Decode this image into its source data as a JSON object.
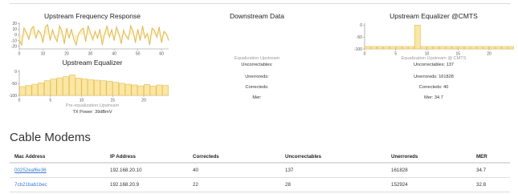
{
  "sections": {
    "upstream_freq": {
      "title": "Upstream Frequency Response"
    },
    "upstream_eq": {
      "title": "Upstream Equalizer",
      "caption1": "Pre-equalization Upstream",
      "caption2": "TX Power: 39dBmV"
    },
    "downstream": {
      "title": "Downstream Data",
      "eq_label": "Equalization Upstream",
      "uncorrectables": "Uncorrectables:",
      "unerroreds": "Unerroreds:",
      "correcteds": "Correcteds:",
      "mer": "Mer:"
    },
    "cmts": {
      "title": "Upstream Equalizer @CMTS",
      "eq_label": "Equalization Upstream @ CMTS",
      "uncorrectables": "Uncorrectables: 137",
      "unerroreds": "Unerroreds: 161828",
      "correcteds": "Correcteds: 40",
      "mer": "Mer: 34.7"
    }
  },
  "cable_modems": {
    "heading": "Cable Modems",
    "columns": [
      "Mac Address",
      "IP Address",
      "Correcteds",
      "Uncorrectables",
      "Unerroreds",
      "MER"
    ],
    "rows": [
      [
        "00252eaf6e36",
        "192.168.20.10",
        "40",
        "137",
        "161828",
        "34.7"
      ],
      [
        "7cb21bab1bec",
        "192.168.20.9",
        "22",
        "28",
        "152924",
        "32.8"
      ]
    ]
  },
  "colors": {
    "fill": "#fbe6a4",
    "stroke": "#e3bd57",
    "link": "#3a7bd5"
  },
  "chart_data": [
    {
      "type": "line",
      "title": "Upstream Frequency Response",
      "xlim": [
        0,
        63
      ],
      "ylim": [
        -25,
        22
      ],
      "xticks": [
        0,
        10,
        20,
        30,
        40,
        50,
        60
      ],
      "yticks": [
        20,
        10,
        0,
        -10,
        -20
      ],
      "ytick_labels": [
        "20",
        "10",
        "0",
        "-10",
        "-20"
      ],
      "x": [
        0,
        1,
        2,
        3,
        4,
        5,
        6,
        7,
        8,
        9,
        10,
        11,
        12,
        13,
        14,
        15,
        16,
        17,
        18,
        19,
        20,
        21,
        22,
        23,
        24,
        25,
        26,
        27,
        28,
        29,
        30,
        31,
        32,
        33,
        34,
        35,
        36,
        37,
        38,
        39,
        40,
        41,
        42,
        43,
        44,
        45,
        46,
        47,
        48,
        49,
        50,
        51,
        52,
        53,
        54,
        55,
        56,
        57,
        58,
        59,
        60,
        61,
        62,
        63
      ],
      "y": [
        -10,
        -18,
        12,
        4,
        -8,
        10,
        15,
        -6,
        8,
        3,
        -14,
        14,
        18,
        -10,
        9,
        -4,
        -12,
        16,
        6,
        -16,
        12,
        -6,
        10,
        -8,
        -18,
        2,
        8,
        12,
        -12,
        16,
        4,
        -9,
        6,
        -6,
        10,
        -18,
        2,
        16,
        -4,
        9,
        -10,
        14,
        2,
        -16,
        8,
        -2,
        -8,
        16,
        6,
        -14,
        10,
        -10,
        16,
        -6,
        2,
        -18,
        12,
        8,
        -4,
        14,
        -14,
        6,
        2,
        -10
      ]
    },
    {
      "type": "bar",
      "title": "Upstream Equalizer",
      "xlim": [
        0,
        24
      ],
      "ylim": [
        -100,
        8
      ],
      "xticks": [
        0,
        5,
        10,
        15,
        20
      ],
      "yticks": [
        0,
        -50,
        -100
      ],
      "ytick_labels": [
        "0",
        "-50",
        "-100"
      ],
      "values": [
        -63,
        -58,
        -53,
        -47,
        -38,
        -31,
        -26,
        -21,
        -14,
        -27,
        -31,
        -34,
        -36,
        -38,
        -40,
        -45,
        -49,
        -53,
        -56,
        -60,
        -54,
        -61,
        -56,
        -58
      ]
    },
    {
      "type": "bar",
      "title": "Upstream Equalizer @CMTS",
      "xlim": [
        0,
        24
      ],
      "ylim": [
        -100,
        8
      ],
      "xticks": [
        0,
        5,
        10,
        15,
        20
      ],
      "yticks": [
        0,
        -50,
        -100
      ],
      "ytick_labels": [
        "0",
        "-50",
        "-100"
      ],
      "values": [
        -90,
        -90,
        -90,
        -90,
        -90,
        -90,
        -90,
        -90,
        0,
        -90,
        -90,
        -90,
        -90,
        -90,
        -90,
        -90,
        -90,
        -90,
        -90,
        -90,
        -90,
        -90,
        -90,
        -90
      ]
    }
  ]
}
